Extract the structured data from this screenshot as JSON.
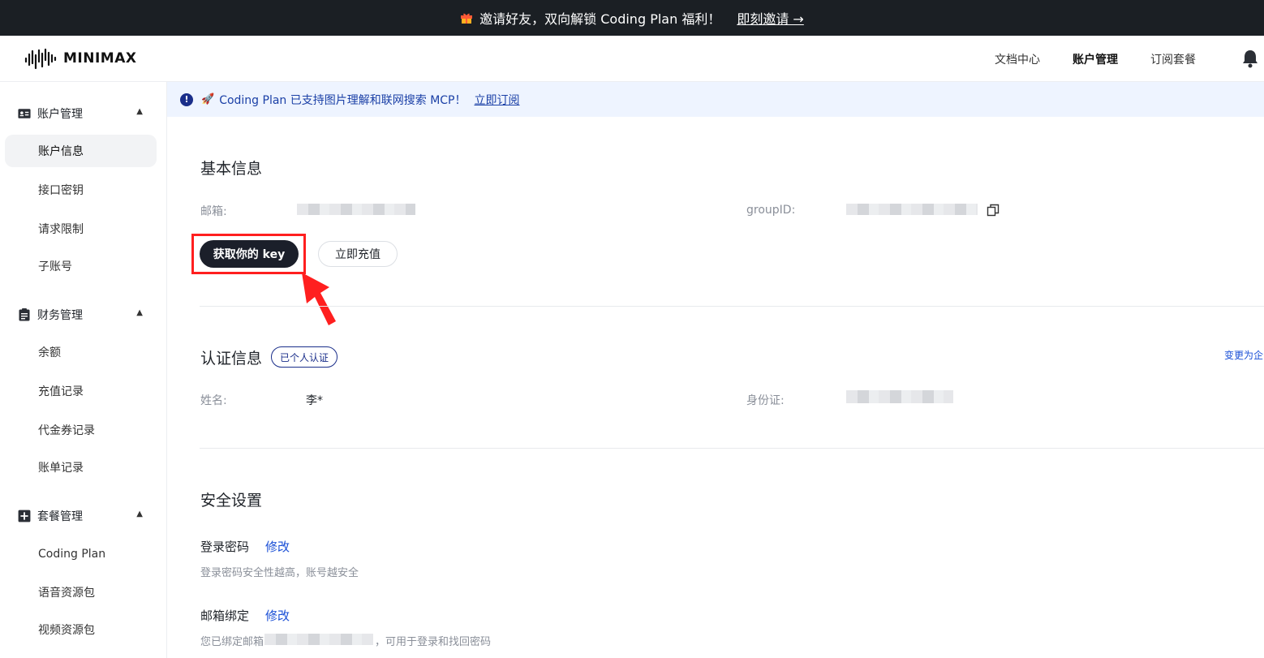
{
  "promo": {
    "text": "邀请好友，双向解锁 Coding Plan 福利！",
    "link": "即刻邀请 →"
  },
  "brand": {
    "name": "MINIMAX"
  },
  "topnav": {
    "items": [
      {
        "label": "文档中心"
      },
      {
        "label": "账户管理"
      },
      {
        "label": "订阅套餐"
      }
    ]
  },
  "sidebar": {
    "groups": [
      {
        "label": "账户管理",
        "icon": "id-card-icon",
        "items": [
          "账户信息",
          "接口密钥",
          "请求限制",
          "子账号"
        ]
      },
      {
        "label": "财务管理",
        "icon": "finance-icon",
        "items": [
          "余额",
          "充值记录",
          "代金券记录",
          "账单记录"
        ]
      },
      {
        "label": "套餐管理",
        "icon": "plan-icon",
        "items": [
          "Coding Plan",
          "语音资源包",
          "视频资源包"
        ]
      }
    ]
  },
  "notice": {
    "icon": "🚀",
    "text": "Coding Plan 已支持图片理解和联网搜索 MCP！",
    "link": "立即订阅"
  },
  "basic": {
    "title": "基本信息",
    "email_label": "邮箱:",
    "group_label": "groupID:",
    "get_key": "获取你的 key",
    "recharge": "立即充值"
  },
  "auth": {
    "title": "认证信息",
    "badge": "已个人认证",
    "change": "变更为企",
    "name_label": "姓名:",
    "name_value": "李*",
    "id_label": "身份证:"
  },
  "security": {
    "title": "安全设置",
    "password_title": "登录密码",
    "password_edit": "修改",
    "password_hint": "登录密码安全性越高，账号越安全",
    "email_title": "邮箱绑定",
    "email_edit": "修改",
    "email_hint_prefix": "您已绑定邮箱",
    "email_hint_suffix": "，可用于登录和找回密码"
  },
  "colors": {
    "dark": "#1b1f24",
    "accent_blue": "#1a4fd6",
    "notice_bg": "#eef4ff",
    "highlight_red": "#ff1f1f"
  }
}
